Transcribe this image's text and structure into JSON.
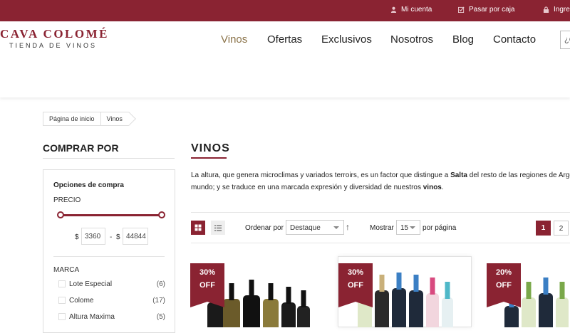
{
  "topbar": {
    "account": "Mi cuenta",
    "checkout": "Pasar por caja",
    "login": "Ingres"
  },
  "logo": {
    "main": "CAVA COLOMÉ",
    "sub": "TIENDA DE VINOS"
  },
  "nav": {
    "wines": "Vinos",
    "offers": "Ofertas",
    "exclusives": "Exclusivos",
    "about": "Nosotros",
    "blog": "Blog",
    "contact": "Contacto"
  },
  "search": {
    "partial": "¿C"
  },
  "breadcrumb": {
    "home": "Página de inicio",
    "current": "Vinos"
  },
  "sidebar": {
    "title": "COMPRAR POR",
    "options_title": "Opciones de compra",
    "price_label": "PRECIO",
    "currency": "$",
    "price_min": "3360",
    "price_max": "44844",
    "dash": "-",
    "brand_label": "MARCA",
    "brands": [
      {
        "name": "Lote Especial",
        "count": "(6)"
      },
      {
        "name": "Colome",
        "count": "(17)"
      },
      {
        "name": "Altura Maxima",
        "count": "(5)"
      }
    ]
  },
  "main": {
    "title": "VINOS",
    "desc_line1_a": "La altura, que genera microclimas y variados terroirs, es un factor que distingue a ",
    "desc_line1_b": "Salta",
    "desc_line1_c": " del resto de las regiones de Arge",
    "desc_line2_a": "mundo; y se traduce en una marcada expresión y diversidad de nuestros ",
    "desc_line2_b": "vinos",
    "desc_line2_c": "."
  },
  "toolbar": {
    "sort_label": "Ordenar por",
    "sort_value": "Destaque",
    "sort_direction": "↑",
    "show_label": "Mostrar",
    "show_value": "15",
    "per_page": "por página",
    "pages": [
      "1",
      "2"
    ]
  },
  "products": [
    {
      "discount": "30%",
      "off": "OFF"
    },
    {
      "discount": "30%",
      "off": "OFF"
    },
    {
      "discount": "20%",
      "off": "OFF"
    }
  ],
  "colors": {
    "brand": "#8a2332",
    "nav_active": "#8b7349"
  }
}
